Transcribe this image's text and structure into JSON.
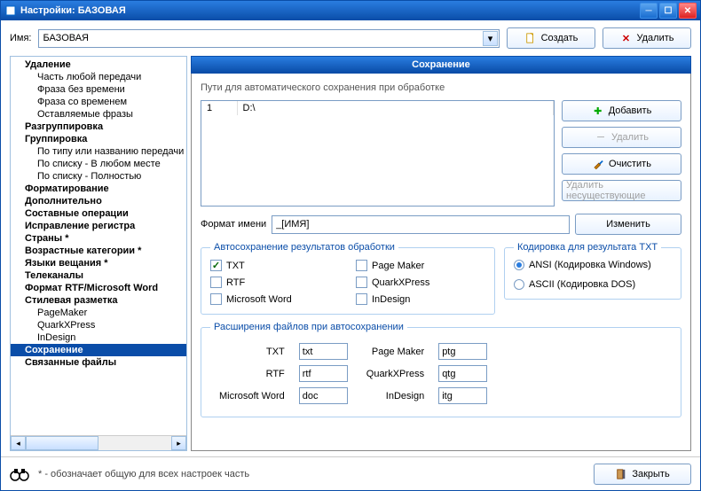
{
  "window": {
    "title": "Настройки: БАЗОВАЯ"
  },
  "top": {
    "name_label": "Имя:",
    "name_value": "БАЗОВАЯ",
    "create": "Создать",
    "delete": "Удалить"
  },
  "sidebar": {
    "items": [
      {
        "label": "Удаление",
        "lev": 1
      },
      {
        "label": "Часть любой передачи",
        "lev": 2
      },
      {
        "label": "Фраза без времени",
        "lev": 2
      },
      {
        "label": "Фраза со временем",
        "lev": 2
      },
      {
        "label": "Оставляемые фразы",
        "lev": 2
      },
      {
        "label": "Разгруппировка",
        "lev": 1
      },
      {
        "label": "Группировка",
        "lev": 1
      },
      {
        "label": "По типу или названию передачи",
        "lev": 2
      },
      {
        "label": "По списку - В любом месте",
        "lev": 2
      },
      {
        "label": "По списку - Полностью",
        "lev": 2
      },
      {
        "label": "Форматирование",
        "lev": 1
      },
      {
        "label": "Дополнительно",
        "lev": 1
      },
      {
        "label": "Составные операции",
        "lev": 1
      },
      {
        "label": "Исправление регистра",
        "lev": 1
      },
      {
        "label": "Страны *",
        "lev": 1
      },
      {
        "label": "Возрастные категории *",
        "lev": 1
      },
      {
        "label": "Языки вещания *",
        "lev": 1
      },
      {
        "label": "Телеканалы",
        "lev": 1
      },
      {
        "label": "Формат RTF/Microsoft Word",
        "lev": 1
      },
      {
        "label": "Стилевая разметка",
        "lev": 1
      },
      {
        "label": "PageMaker",
        "lev": 2
      },
      {
        "label": "QuarkXPress",
        "lev": 2
      },
      {
        "label": "InDesign",
        "lev": 2
      },
      {
        "label": "Сохранение",
        "lev": 1,
        "sel": true
      },
      {
        "label": "Связанные файлы",
        "lev": 1
      }
    ]
  },
  "main": {
    "title": "Сохранение",
    "paths_label": "Пути для автоматического сохранения при обработке",
    "path_rows": [
      {
        "n": "1",
        "path": "D:\\"
      }
    ],
    "btns": {
      "add": "Добавить",
      "del": "Удалить",
      "clear": "Очистить",
      "del_nonexist": "Удалить несуществующие",
      "change": "Изменить"
    },
    "fmt_label": "Формат имени",
    "fmt_value": "_[ИМЯ]",
    "autosave_legend": "Автосохранение результатов обработки",
    "chk": {
      "txt": "TXT",
      "pm": "Page Maker",
      "rtf": "RTF",
      "qx": "QuarkXPress",
      "mw": "Microsoft Word",
      "id": "InDesign"
    },
    "enc_legend": "Кодировка для результата TXT",
    "enc": {
      "ansi": "ANSI (Кодировка Windows)",
      "ascii": "ASCII (Кодировка DOS)"
    },
    "ext_legend": "Расширения файлов при автосохранении",
    "ext": {
      "txt_l": "TXT",
      "txt_v": "txt",
      "rtf_l": "RTF",
      "rtf_v": "rtf",
      "mw_l": "Microsoft Word",
      "mw_v": "doc",
      "pm_l": "Page Maker",
      "pm_v": "ptg",
      "qx_l": "QuarkXPress",
      "qx_v": "qtg",
      "id_l": "InDesign",
      "id_v": "itg"
    }
  },
  "footer": {
    "note": "* - обозначает общую для всех настроек часть",
    "close": "Закрыть"
  }
}
